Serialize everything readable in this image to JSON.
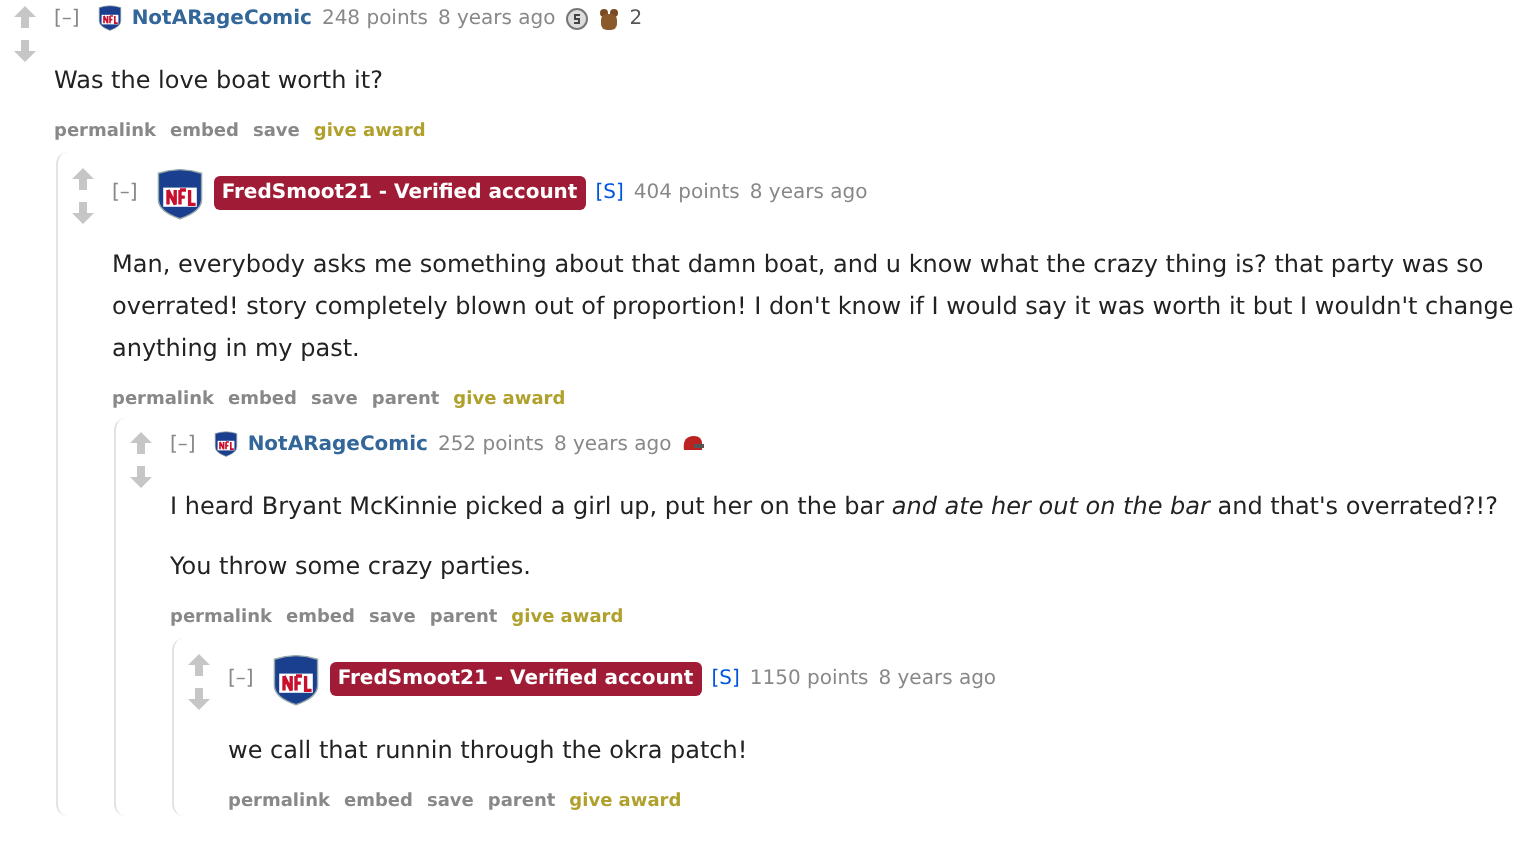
{
  "comment": {
    "author": "NotARageComic",
    "kind": "plain",
    "score": "248 points",
    "time": "8 years ago",
    "collapse": "[–]",
    "awards": [
      {
        "kind": "silver"
      },
      {
        "kind": "bear",
        "count": "2"
      }
    ],
    "body": [
      "Was the love boat worth it?"
    ],
    "actions": [
      {
        "label": "permalink",
        "kind": "link"
      },
      {
        "label": "embed",
        "kind": "link"
      },
      {
        "label": "save",
        "kind": "link"
      },
      {
        "label": "give award",
        "kind": "award"
      }
    ],
    "children": [
      {
        "author": "FredSmoot21 - Verified account",
        "kind": "verified",
        "submitter_mark": "[S]",
        "score": "404 points",
        "time": "8 years ago",
        "collapse": "[–]",
        "body": [
          "Man, everybody asks me something about that damn boat, and u know what the crazy thing is? that party was so overrated! story completely blown out of proportion! I don't know if I would say it was worth it but I wouldn't change anything in my past."
        ],
        "actions": [
          {
            "label": "permalink",
            "kind": "link"
          },
          {
            "label": "embed",
            "kind": "link"
          },
          {
            "label": "save",
            "kind": "link"
          },
          {
            "label": "parent",
            "kind": "link"
          },
          {
            "label": "give award",
            "kind": "award"
          }
        ],
        "children": [
          {
            "author": "NotARageComic",
            "kind": "plain",
            "score": "252 points",
            "time": "8 years ago",
            "collapse": "[–]",
            "awards": [
              {
                "kind": "helmet"
              }
            ],
            "body": [
              "I heard Bryant McKinnie picked a girl up, put her on the bar *and ate her out on the bar* and that's overrated?!?",
              "You throw some crazy parties."
            ],
            "actions": [
              {
                "label": "permalink",
                "kind": "link"
              },
              {
                "label": "embed",
                "kind": "link"
              },
              {
                "label": "save",
                "kind": "link"
              },
              {
                "label": "parent",
                "kind": "link"
              },
              {
                "label": "give award",
                "kind": "award"
              }
            ],
            "children": [
              {
                "author": "FredSmoot21 - Verified account",
                "kind": "verified",
                "submitter_mark": "[S]",
                "score": "1150 points",
                "time": "8 years ago",
                "collapse": "[–]",
                "body": [
                  "we call that runnin through the okra patch!"
                ],
                "actions": [
                  {
                    "label": "permalink",
                    "kind": "link"
                  },
                  {
                    "label": "embed",
                    "kind": "link"
                  },
                  {
                    "label": "save",
                    "kind": "link"
                  },
                  {
                    "label": "parent",
                    "kind": "link"
                  },
                  {
                    "label": "give award",
                    "kind": "award"
                  }
                ]
              }
            ]
          }
        ]
      }
    ]
  }
}
